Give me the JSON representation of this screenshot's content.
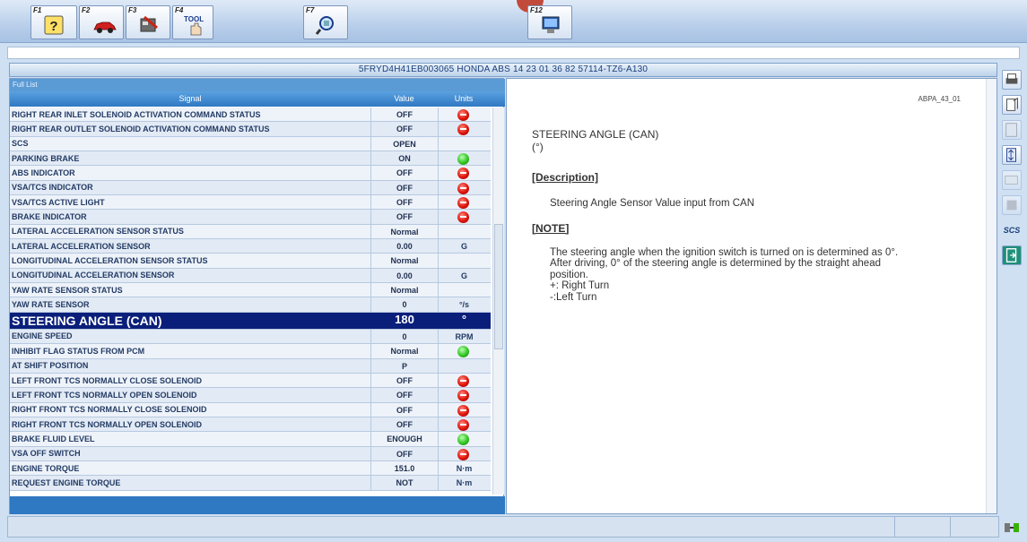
{
  "toolbar": {
    "keys": [
      {
        "label": "F1",
        "icon": "help-icon"
      },
      {
        "label": "F2",
        "icon": "car-icon"
      },
      {
        "label": "F3",
        "icon": "ecu-icon"
      },
      {
        "label": "F4",
        "icon": "tool-icon",
        "text": "TOOL"
      },
      {
        "label": "F7",
        "icon": "magnifier-icon"
      },
      {
        "label": "F12",
        "icon": "monitor-icon"
      }
    ]
  },
  "vin_header": "5FRYD4H41EB003065  HONDA ABS  14 23 01 36 82  57114-TZ6-A130",
  "list": {
    "title": "Full List",
    "columns": {
      "signal": "Signal",
      "value": "Value",
      "units": "Units"
    },
    "rows": [
      {
        "signal": "RIGHT REAR INLET SOLENOID ACTIVATION COMMAND STATUS",
        "value": "OFF",
        "unit": "",
        "lamp": "red"
      },
      {
        "signal": "RIGHT REAR OUTLET SOLENOID ACTIVATION COMMAND STATUS",
        "value": "OFF",
        "unit": "",
        "lamp": "red"
      },
      {
        "signal": "SCS",
        "value": "OPEN",
        "unit": "",
        "lamp": ""
      },
      {
        "signal": "PARKING BRAKE",
        "value": "ON",
        "unit": "",
        "lamp": "green"
      },
      {
        "signal": "ABS INDICATOR",
        "value": "OFF",
        "unit": "",
        "lamp": "red"
      },
      {
        "signal": "VSA/TCS INDICATOR",
        "value": "OFF",
        "unit": "",
        "lamp": "red"
      },
      {
        "signal": "VSA/TCS ACTIVE LIGHT",
        "value": "OFF",
        "unit": "",
        "lamp": "red"
      },
      {
        "signal": "BRAKE INDICATOR",
        "value": "OFF",
        "unit": "",
        "lamp": "red"
      },
      {
        "signal": "LATERAL ACCELERATION SENSOR STATUS",
        "value": "Normal",
        "unit": "",
        "lamp": ""
      },
      {
        "signal": "LATERAL ACCELERATION SENSOR",
        "value": "0.00",
        "unit": "G",
        "lamp": ""
      },
      {
        "signal": "LONGITUDINAL ACCELERATION SENSOR STATUS",
        "value": "Normal",
        "unit": "",
        "lamp": ""
      },
      {
        "signal": "LONGITUDINAL ACCELERATION SENSOR",
        "value": "0.00",
        "unit": "G",
        "lamp": ""
      },
      {
        "signal": "YAW RATE SENSOR STATUS",
        "value": "Normal",
        "unit": "",
        "lamp": ""
      },
      {
        "signal": "YAW RATE SENSOR",
        "value": "0",
        "unit": "°/s",
        "lamp": ""
      },
      {
        "signal": "STEERING ANGLE (CAN)",
        "value": "180",
        "unit": "°",
        "lamp": "",
        "selected": true
      },
      {
        "signal": "ENGINE SPEED",
        "value": "0",
        "unit": "RPM",
        "lamp": ""
      },
      {
        "signal": "INHIBIT FLAG STATUS FROM PCM",
        "value": "Normal",
        "unit": "",
        "lamp": "green"
      },
      {
        "signal": "AT SHIFT POSITION",
        "value": "P",
        "unit": "",
        "lamp": ""
      },
      {
        "signal": "LEFT FRONT TCS NORMALLY CLOSE SOLENOID",
        "value": "OFF",
        "unit": "",
        "lamp": "red"
      },
      {
        "signal": "LEFT FRONT TCS NORMALLY OPEN SOLENOID",
        "value": "OFF",
        "unit": "",
        "lamp": "red"
      },
      {
        "signal": "RIGHT FRONT TCS NORMALLY CLOSE SOLENOID",
        "value": "OFF",
        "unit": "",
        "lamp": "red"
      },
      {
        "signal": "RIGHT FRONT TCS NORMALLY OPEN SOLENOID",
        "value": "OFF",
        "unit": "",
        "lamp": "red"
      },
      {
        "signal": "BRAKE FLUID LEVEL",
        "value": "ENOUGH",
        "unit": "",
        "lamp": "green"
      },
      {
        "signal": "VSA OFF SWITCH",
        "value": "OFF",
        "unit": "",
        "lamp": "red"
      },
      {
        "signal": "ENGINE TORQUE",
        "value": "151.0",
        "unit": "N·m",
        "lamp": ""
      },
      {
        "signal": "REQUEST ENGINE TORQUE",
        "value": "NOT",
        "unit": "N·m",
        "lamp": ""
      }
    ]
  },
  "doc": {
    "id": "ABPA_43_01",
    "title": "STEERING ANGLE (CAN)",
    "unit_line": "(°)",
    "description_head": "[Description]",
    "description": "Steering Angle Sensor Value input from CAN",
    "note_head": "[NOTE]",
    "note_lines": [
      "The steering angle when the ignition switch is turned on is determined as 0°.",
      "After driving, 0° of the steering angle is determined by the straight ahead",
      "position.",
      "+: Right Turn",
      "-:Left Turn"
    ]
  },
  "sidetools": [
    {
      "name": "print-icon"
    },
    {
      "name": "snapshot-icon"
    },
    {
      "name": "list-icon",
      "dim": true
    },
    {
      "name": "sort-icon"
    },
    {
      "name": "graph-icon",
      "dim": true
    },
    {
      "name": "ecu-select-icon",
      "dim": true
    },
    {
      "name": "scs-icon",
      "text": "SCS"
    },
    {
      "name": "exit-icon"
    }
  ]
}
